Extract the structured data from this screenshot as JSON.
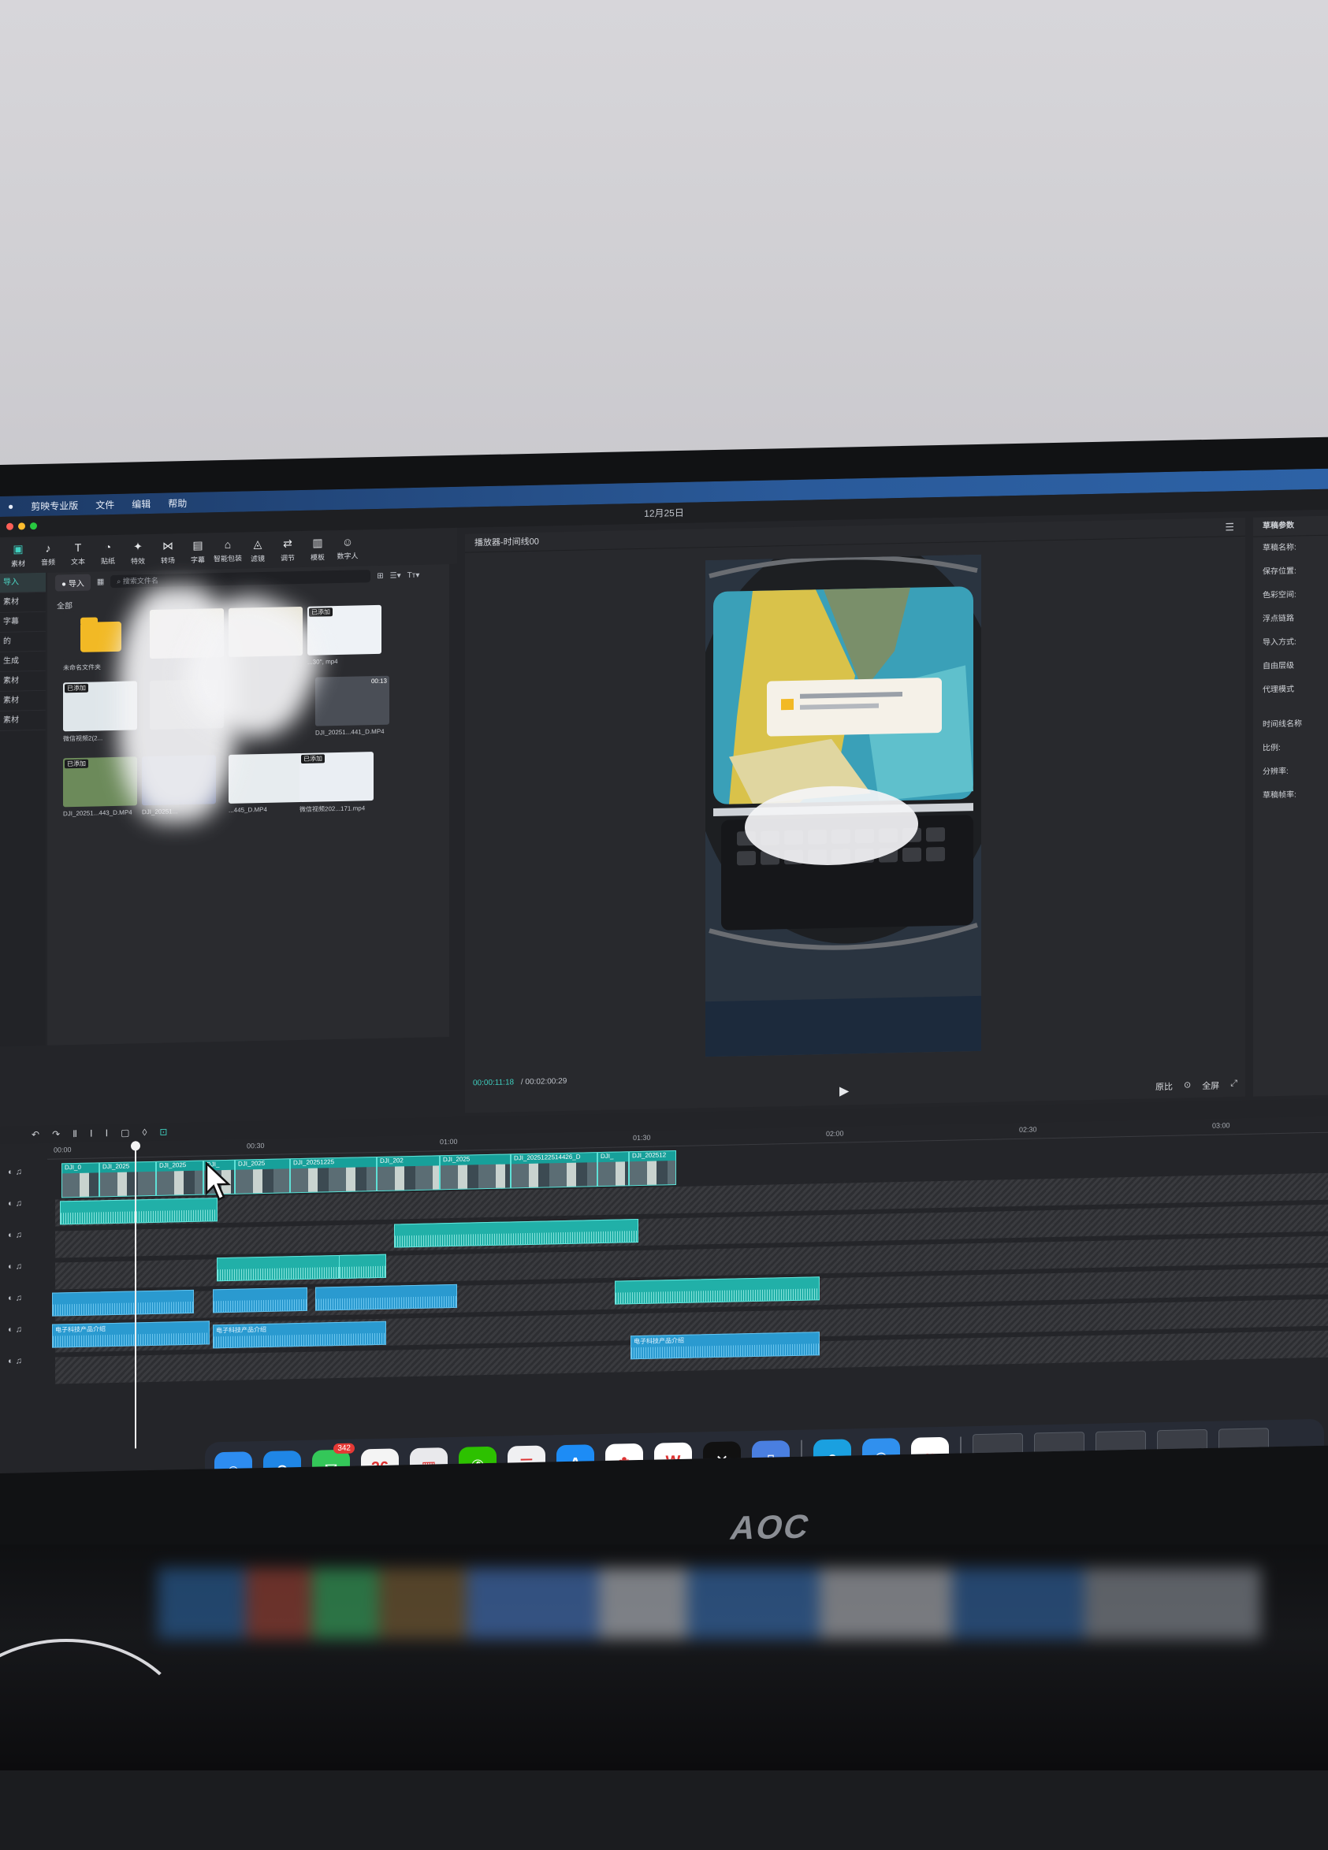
{
  "menubar": {
    "app_name": "剪映专业版",
    "items": [
      "文件",
      "编辑",
      "帮助"
    ]
  },
  "titlebar": {
    "date": "12月25日"
  },
  "toolbar": {
    "tools": [
      {
        "label": "素材",
        "icon": "media-icon"
      },
      {
        "label": "音频",
        "icon": "audio-icon"
      },
      {
        "label": "文本",
        "icon": "text-icon"
      },
      {
        "label": "贴纸",
        "icon": "sticker-icon"
      },
      {
        "label": "特效",
        "icon": "effects-icon"
      },
      {
        "label": "转场",
        "icon": "transition-icon"
      },
      {
        "label": "字幕",
        "icon": "subtitle-icon"
      },
      {
        "label": "智能包装",
        "icon": "smart-pack-icon"
      },
      {
        "label": "滤镜",
        "icon": "filter-icon"
      },
      {
        "label": "调节",
        "icon": "adjust-icon"
      },
      {
        "label": "模板",
        "icon": "template-icon"
      },
      {
        "label": "数字人",
        "icon": "digital-human-icon"
      }
    ]
  },
  "sidebar": {
    "items": [
      "导入",
      "素材",
      "字幕",
      "的",
      "生成",
      "素材",
      "素材",
      "素材"
    ]
  },
  "media": {
    "import_label": "导入",
    "search_placeholder": "搜索文件名",
    "all_label": "全部",
    "items": [
      {
        "caption": "未命名文件夹",
        "badge": "",
        "duration": ""
      },
      {
        "caption": "",
        "badge": "",
        "duration": ""
      },
      {
        "caption": "",
        "badge": "",
        "duration": ""
      },
      {
        "caption": "...30'', mp4",
        "badge": "已添加",
        "duration": ""
      },
      {
        "caption": "微信视频2(2...",
        "badge": "已添加",
        "duration": ""
      },
      {
        "caption": "",
        "badge": "",
        "duration": ""
      },
      {
        "caption": "DJI_20251...441_D.MP4",
        "badge": "",
        "duration": "00:13"
      },
      {
        "caption": "DJI_20251...443_D.MP4",
        "badge": "已添加",
        "duration": ""
      },
      {
        "caption": "DJI_20251...",
        "badge": "",
        "duration": ""
      },
      {
        "caption": "...445_D.MP4",
        "badge": "",
        "duration": ""
      },
      {
        "caption": "微信视频202...171.mp4",
        "badge": "已添加",
        "duration": ""
      }
    ]
  },
  "player": {
    "title": "播放器-时间线00",
    "current_time": "00:00:11:18",
    "total_time": "/ 00:02:00:29",
    "controls": [
      "原比",
      "全屏"
    ]
  },
  "properties": {
    "title": "草稿参数",
    "rows": [
      "草稿名称:",
      "保存位置:",
      "色彩空间:",
      "浮点链路",
      "导入方式:",
      "自由层级",
      "代理模式"
    ],
    "rows2": [
      "时间线名称",
      "比例:",
      "分辨率:",
      "草稿帧率:"
    ]
  },
  "timeline": {
    "ruler": [
      "00:00",
      "00:30",
      "01:00",
      "01:30",
      "02:00",
      "02:30",
      "03:00"
    ],
    "video_clips": [
      "DJI_0",
      "DJI_2025",
      "DJI_2025",
      "DJI_",
      "DJI_2025",
      "DJI_20251225",
      "DJI_202",
      "DJI_2025",
      "DJI_2025122514426_D",
      "DJI_",
      "DJI_202512"
    ],
    "audio_labels": [
      "电子科技产品介绍",
      "电子科技产品介绍",
      "电子科技产品介绍"
    ]
  },
  "dock": {
    "apps": [
      {
        "name": "finder-icon",
        "glyph": "☺",
        "color": "#2d8cf0",
        "badge": ""
      },
      {
        "name": "safari-icon",
        "glyph": "⊛",
        "color": "#1f86e6",
        "badge": ""
      },
      {
        "name": "messages-icon",
        "glyph": "✉",
        "color": "#34c759",
        "badge": "342"
      },
      {
        "name": "calendar-icon",
        "glyph": "26",
        "color": "#f4f4f4",
        "badge": ""
      },
      {
        "name": "launchpad-icon",
        "glyph": "▦",
        "color": "#e9e9ec",
        "badge": ""
      },
      {
        "name": "wechat-icon",
        "glyph": "✆",
        "color": "#2dc100",
        "badge": ""
      },
      {
        "name": "reminders-icon",
        "glyph": "☰",
        "color": "#f0f0f2",
        "badge": ""
      },
      {
        "name": "app-store-icon",
        "glyph": "A",
        "color": "#1d8cf5",
        "badge": ""
      },
      {
        "name": "photos-icon",
        "glyph": "✿",
        "color": "#ffffff",
        "badge": ""
      },
      {
        "name": "wps-icon",
        "glyph": "W",
        "color": "#ffffff",
        "badge": ""
      },
      {
        "name": "capcut-icon",
        "glyph": "✕",
        "color": "#111111",
        "badge": ""
      },
      {
        "name": "phone-mirror-icon",
        "glyph": "▯",
        "color": "#4a7fe0",
        "badge": ""
      },
      {
        "name": "edge-icon",
        "glyph": "e",
        "color": "#1aa0e0",
        "badge": ""
      },
      {
        "name": "storage-icon",
        "glyph": "◉",
        "color": "#3090ee",
        "badge": ""
      },
      {
        "name": "baidu-netdisk-icon",
        "glyph": "∞",
        "color": "#ffffff",
        "badge": ""
      }
    ]
  },
  "monitor_brand": "AOC",
  "colors": {
    "accent": "#3fd0c0",
    "video_clip": "#17a09a",
    "audio_clip": "#2a9ad0",
    "folder": "#f2b925"
  }
}
